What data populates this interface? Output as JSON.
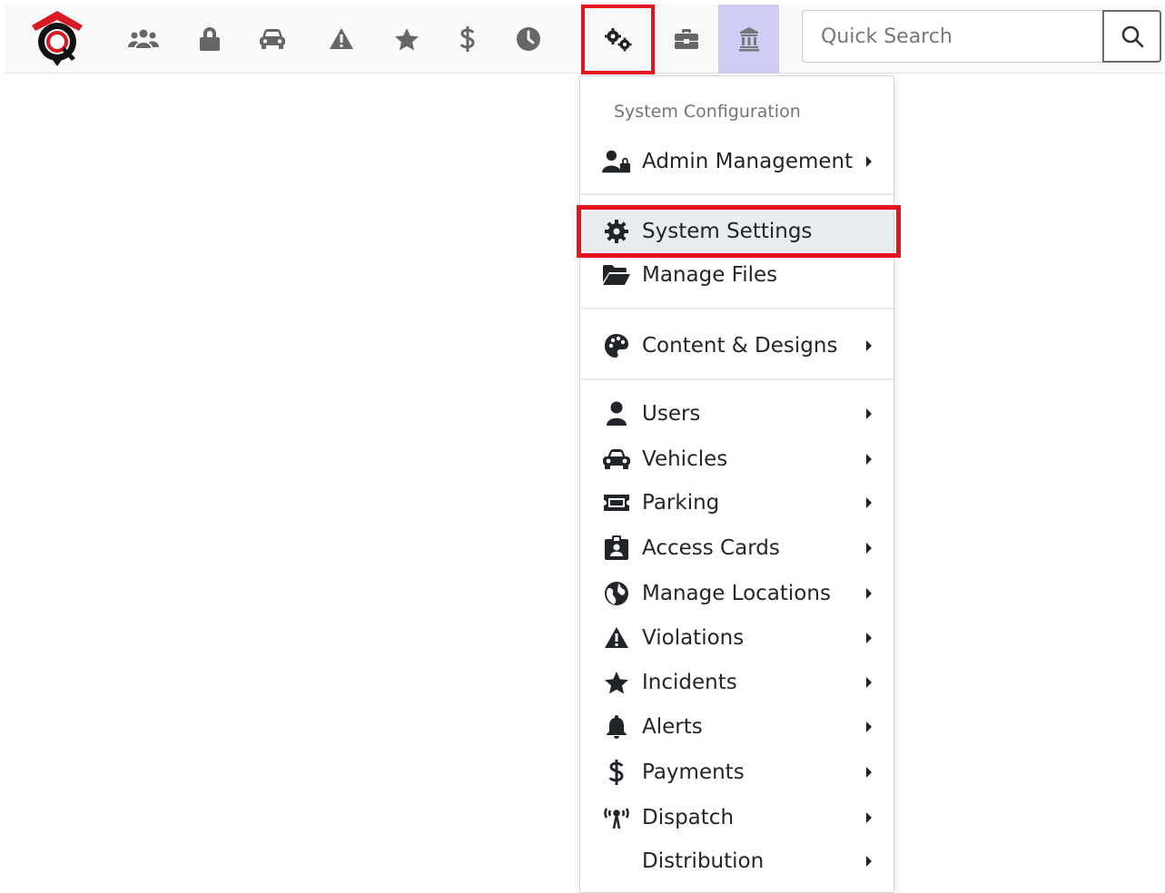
{
  "app": {
    "brand_colors": {
      "logo_red": "#d71921",
      "logo_black": "#111111",
      "accent_outline": "#e4141f",
      "highlight_tab": "#cfcdf6"
    }
  },
  "navbar": {
    "icons": [
      {
        "name": "users-group-icon"
      },
      {
        "name": "lock-icon"
      },
      {
        "name": "car-icon"
      },
      {
        "name": "warning-icon"
      },
      {
        "name": "star-icon"
      },
      {
        "name": "dollar-icon"
      },
      {
        "name": "clock-icon"
      },
      {
        "name": "cogs-icon",
        "state": "active"
      },
      {
        "name": "briefcase-icon"
      },
      {
        "name": "gavel-building-icon",
        "state": "highlighted"
      }
    ],
    "search": {
      "placeholder": "Quick Search",
      "value": ""
    }
  },
  "dropdown": {
    "header": "System Configuration",
    "items": [
      {
        "label": "Admin Management",
        "icon": "user-lock-icon",
        "has_submenu": true
      },
      {
        "label": "System Settings",
        "icon": "cog-icon",
        "has_submenu": false,
        "selected": true
      },
      {
        "label": "Manage Files",
        "icon": "folder-open-icon",
        "has_submenu": false
      },
      {
        "label": "Content & Designs",
        "icon": "palette-icon",
        "has_submenu": true
      },
      {
        "label": "Users",
        "icon": "user-icon",
        "has_submenu": true
      },
      {
        "label": "Vehicles",
        "icon": "car-icon",
        "has_submenu": true
      },
      {
        "label": "Parking",
        "icon": "ticket-icon",
        "has_submenu": true
      },
      {
        "label": "Access Cards",
        "icon": "id-badge-icon",
        "has_submenu": true
      },
      {
        "label": "Manage Locations",
        "icon": "globe-icon",
        "has_submenu": true
      },
      {
        "label": "Violations",
        "icon": "warning-icon",
        "has_submenu": true
      },
      {
        "label": "Incidents",
        "icon": "star-icon",
        "has_submenu": true
      },
      {
        "label": "Alerts",
        "icon": "bell-icon",
        "has_submenu": true
      },
      {
        "label": "Payments",
        "icon": "dollar-icon",
        "has_submenu": true
      },
      {
        "label": "Dispatch",
        "icon": "broadcast-tower-icon",
        "has_submenu": true
      },
      {
        "label": "Distribution",
        "icon": "",
        "has_submenu": true
      }
    ]
  }
}
